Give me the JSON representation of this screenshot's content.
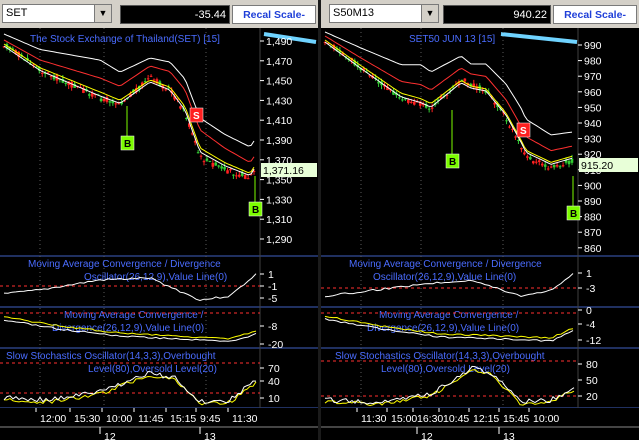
{
  "colors": {
    "price_up": "#32cd32",
    "price_down": "#ff2020",
    "ma_fast": "#ffff00",
    "ma_mid": "#ff3030",
    "ma_slow": "#ffffff",
    "ind_title": "#4a6cff",
    "axis_text": "#ffffff",
    "tag_buy": "#7cfc00",
    "tag_sell": "#ff2020",
    "osc_line": "#ffffff",
    "osc_signal": "#ffff00",
    "level_line": "#ff3030"
  },
  "left": {
    "symbol": "SET",
    "change": "-35.44",
    "recal": "Recal Scale-Linear",
    "title": "The Stock Exchange of Thailand(SET) [15]",
    "price_ticks": [
      "1,490",
      "1,470",
      "1,450",
      "1,430",
      "1,410",
      "1,390",
      "1,370",
      "1,350",
      "1,330",
      "1,310",
      "1,290"
    ],
    "last_price": "1,371.16",
    "signals": [
      "B",
      "S",
      "B"
    ],
    "macd_title": [
      "Moving Average Convergence / Divergence",
      "Oscillator(26,12,9),Value Line(0)"
    ],
    "macd_ticks": [
      "1",
      "-1",
      "-5"
    ],
    "macd2_title": [
      "Moving Average Convergence /",
      "Divergence(26,12,9),Value Line(0)"
    ],
    "macd2_ticks": [
      "-8",
      "-20"
    ],
    "stoch_title": [
      "Slow Stochastics Oscillator(14,3,3),Overbought",
      "Level(80),Oversold Level(20)"
    ],
    "stoch_ticks": [
      "70",
      "40",
      "10"
    ],
    "time_labels": [
      "12:00",
      "15:30",
      "10:00",
      "11:45",
      "15:15",
      "9:45",
      "11:30"
    ],
    "day_labels": [
      "12",
      "13"
    ]
  },
  "right": {
    "symbol": "S50M13",
    "change": "940.22",
    "recal": "Recal Scale-Linear",
    "title": "SET50 JUN 13   [15]",
    "price_ticks": [
      "990",
      "980",
      "970",
      "960",
      "950",
      "940",
      "930",
      "920",
      "910",
      "900",
      "890",
      "880",
      "870",
      "860"
    ],
    "last_price": "915.20",
    "signals": [
      "B",
      "S",
      "B"
    ],
    "macd_title": [
      "Moving Average Convergence / Divergence",
      "Oscillator(26,12,9),Value Line(0)"
    ],
    "macd_ticks": [
      "1",
      "-3"
    ],
    "macd2_title": [
      "Moving Average Convergence /",
      "Divergence(26,12,9),Value Line(0)"
    ],
    "macd2_ticks": [
      "0",
      "-4",
      "-12"
    ],
    "stoch_title": [
      "Slow Stochastics Oscillator(14,3,3),Overbought",
      "Level(80),Oversold Level(20)"
    ],
    "stoch_ticks": [
      "80",
      "50",
      "20"
    ],
    "time_labels": [
      "11:30",
      "15:00",
      "16:30",
      "10:45",
      "12:15",
      "15:45",
      "10:00"
    ],
    "day_labels": [
      "12",
      "13"
    ]
  }
}
